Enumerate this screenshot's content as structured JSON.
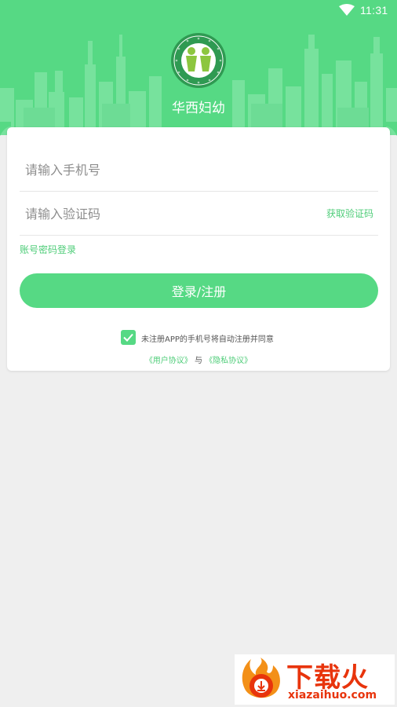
{
  "status_bar": {
    "time": "11:31",
    "wifi_icon": "wifi-icon"
  },
  "header": {
    "logo_icon": "hospital-logo",
    "title": "华西妇幼",
    "background_color": "#56d984"
  },
  "form": {
    "phone_placeholder": "请输入手机号",
    "phone_value": "",
    "code_placeholder": "请输入验证码",
    "code_value": "",
    "get_code_label": "获取验证码",
    "account_login_label": "账号密码登录",
    "login_button_label": "登录/注册",
    "agreement_checked": true,
    "agreement_text": "未注册APP的手机号将自动注册并同意",
    "user_agreement_link": "《用户协议》",
    "and_text": "与",
    "privacy_link": "《隐私协议》",
    "accent_color": "#56d984"
  },
  "watermark": {
    "title": "下载火",
    "url": "xiazaihuo.com",
    "color": "#e8340c"
  }
}
